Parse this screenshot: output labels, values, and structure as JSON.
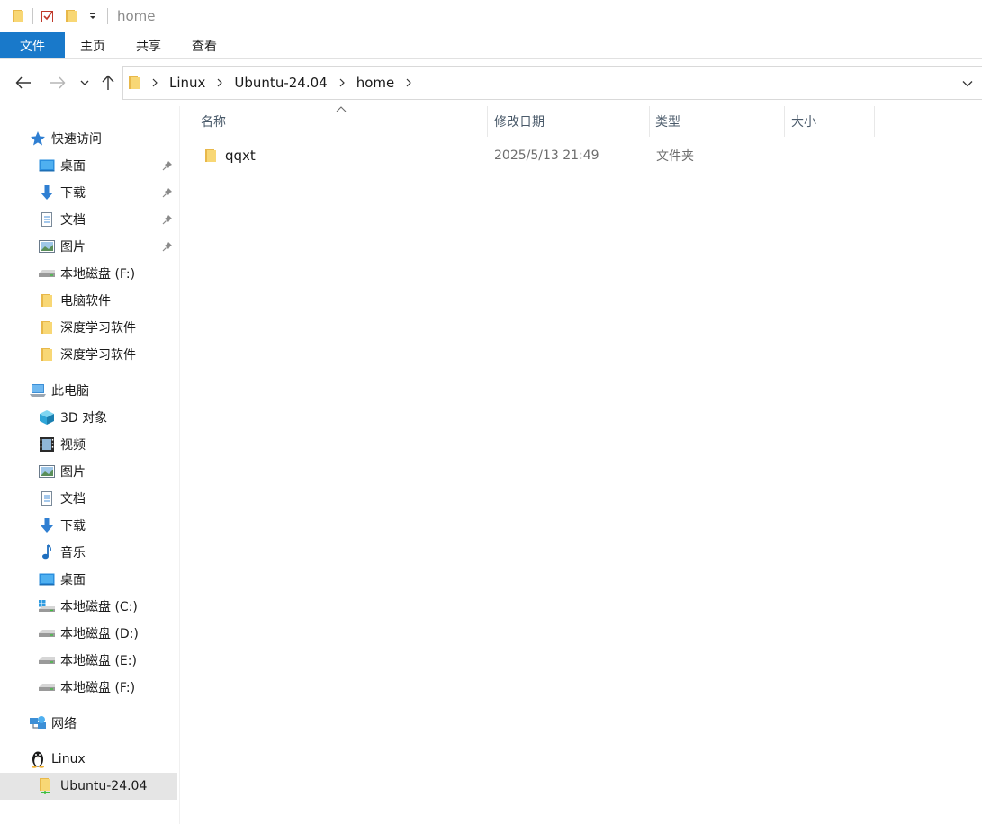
{
  "window": {
    "title": "home"
  },
  "ribbon": {
    "tabs": [
      "文件",
      "主页",
      "共享",
      "查看"
    ]
  },
  "address": {
    "crumbs": [
      "Linux",
      "Ubuntu-24.04",
      "home"
    ]
  },
  "nav": {
    "quick_access": "快速访问",
    "quick_items": [
      "桌面",
      "下载",
      "文档",
      "图片",
      "本地磁盘 (F:)",
      "电脑软件",
      "深度学习软件",
      "深度学习软件"
    ],
    "this_pc": "此电脑",
    "pc_items": [
      "3D 对象",
      "视频",
      "图片",
      "文档",
      "下载",
      "音乐",
      "桌面",
      "本地磁盘 (C:)",
      "本地磁盘 (D:)",
      "本地磁盘 (E:)",
      "本地磁盘 (F:)"
    ],
    "network": "网络",
    "linux": "Linux",
    "ubuntu": "Ubuntu-24.04"
  },
  "columns": {
    "name": "名称",
    "modified": "修改日期",
    "type": "类型",
    "size": "大小"
  },
  "files": [
    {
      "name": "qqxt",
      "modified": "2025/5/13 21:49",
      "type": "文件夹",
      "size": ""
    }
  ],
  "colors": {
    "accent": "#1979ca",
    "folder": "#f8d775",
    "folder_dark": "#e8b84a",
    "selected": "#e5e5e5"
  }
}
